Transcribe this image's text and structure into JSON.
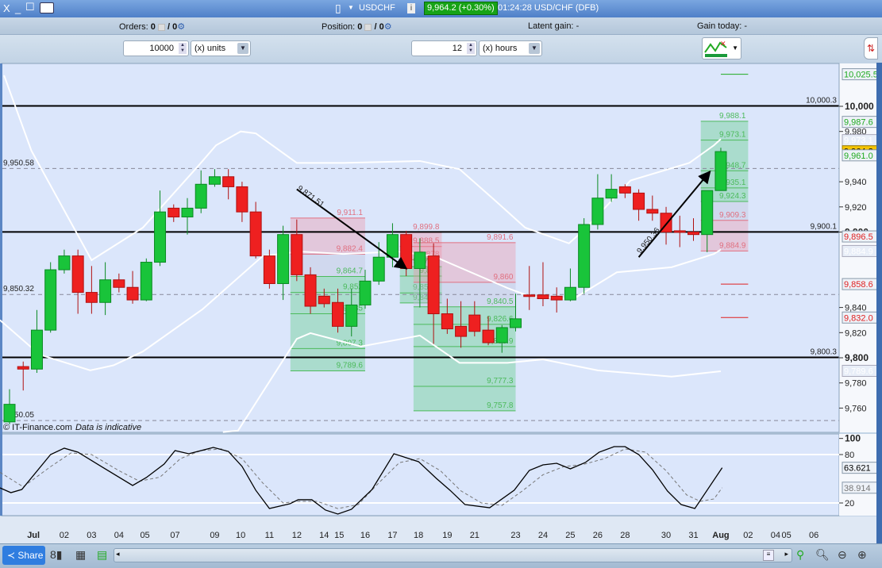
{
  "titlebar": {
    "window_controls": [
      "X",
      "_",
      "☐"
    ],
    "keyboard_icon": "keyboard-icon",
    "symbol": "USDCHF",
    "quote": "9,964.2 (+0.30%)",
    "time_instrument": "01:24:28 USD/CHF (DFB)",
    "quote_color": "#17a317"
  },
  "status": {
    "orders_label": "Orders:",
    "orders_value": "0",
    "orders_total": "/ 0",
    "position_label": "Position:",
    "position_value": "0",
    "position_total": "/ 0",
    "latent_label": "Latent gain:",
    "latent_value": "-",
    "gain_today_label": "Gain today:",
    "gain_today_value": "-"
  },
  "toolbar": {
    "quantity": "10000",
    "quantity_unit": "(x) units",
    "period": "12",
    "period_unit": "(x) hours"
  },
  "chart_data": {
    "type": "candlestick",
    "symbol": "USDCHF",
    "ylim": [
      9745,
      10040
    ],
    "price_ticks": [
      "10,000",
      "9,980",
      "9,940",
      "9,920",
      "9,900",
      "9,840",
      "9,820",
      "9,800",
      "9,780",
      "9,760"
    ],
    "price_tick_values": [
      10000,
      9980,
      9940,
      9920,
      9900,
      9840,
      9820,
      9800,
      9780,
      9760
    ],
    "date_labels": [
      [
        "Jul",
        1.75
      ],
      [
        "02",
        4
      ],
      [
        "03",
        6
      ],
      [
        "04",
        8
      ],
      [
        "05",
        9.9
      ],
      [
        "07",
        12.1
      ],
      [
        "09",
        15
      ],
      [
        "10",
        16.9
      ],
      [
        "11",
        19
      ],
      [
        "12",
        21
      ],
      [
        "14",
        23
      ],
      [
        "15",
        24.1
      ],
      [
        "16",
        26
      ],
      [
        "17",
        28
      ],
      [
        "18",
        29.9
      ],
      [
        "19",
        32
      ],
      [
        "21",
        34
      ],
      [
        "23",
        37
      ],
      [
        "24",
        39
      ],
      [
        "25",
        41
      ],
      [
        "26",
        43
      ],
      [
        "28",
        45
      ],
      [
        "30",
        48
      ],
      [
        "31",
        50
      ],
      [
        "Aug",
        52
      ],
      [
        "02",
        54
      ],
      [
        "04",
        56
      ],
      [
        "05",
        56.8
      ],
      [
        "06",
        58.8
      ]
    ],
    "candles": [
      [
        9749,
        9763,
        9775,
        9747
      ],
      [
        9793,
        9791,
        9797,
        9774
      ],
      [
        9791,
        9822,
        9838,
        9788
      ],
      [
        9822,
        9870,
        9876,
        9820
      ],
      [
        9870,
        9881,
        9886,
        9867
      ],
      [
        9881,
        9852,
        9886,
        9835
      ],
      [
        9852,
        9844,
        9873,
        9835
      ],
      [
        9844,
        9862,
        9876,
        9834
      ],
      [
        9862,
        9856,
        9867,
        9852
      ],
      [
        9856,
        9846,
        9869,
        9843
      ],
      [
        9846,
        9876,
        9879,
        9845
      ],
      [
        9876,
        9916,
        9933,
        9873
      ],
      [
        9919,
        9912,
        9922,
        9908
      ],
      [
        9912,
        9919,
        9927,
        9898
      ],
      [
        9919,
        9938,
        9949,
        9915
      ],
      [
        9938,
        9944,
        9950,
        9936
      ],
      [
        9944,
        9936,
        9950,
        9926
      ],
      [
        9936,
        9916,
        9940,
        9908
      ],
      [
        9916,
        9881,
        9924,
        9879
      ],
      [
        9881,
        9859,
        9886,
        9855
      ],
      [
        9859,
        9898,
        9905,
        9846
      ],
      [
        9898,
        9866,
        9910,
        9861
      ],
      [
        9866,
        9841,
        9872,
        9835
      ],
      [
        9849,
        9843,
        9855,
        9840
      ],
      [
        9844,
        9825,
        9855,
        9820
      ],
      [
        9825,
        9842,
        9855,
        9817
      ],
      [
        9842,
        9861,
        9870,
        9839
      ],
      [
        9861,
        9880,
        9892,
        9858
      ],
      [
        9880,
        9898,
        9907,
        9872
      ],
      [
        9898,
        9871,
        9901,
        9865
      ],
      [
        9871,
        9884,
        9895,
        9840
      ],
      [
        9881,
        9835,
        9891,
        9811
      ],
      [
        9835,
        9823,
        9847,
        9819
      ],
      [
        9825,
        9817,
        9845,
        9808
      ],
      [
        9834,
        9821,
        9845,
        9817
      ],
      [
        9822,
        9812,
        9833,
        9810
      ],
      [
        9812,
        9824,
        9826,
        9804
      ],
      [
        9824,
        9831,
        9851,
        9821
      ],
      [
        9850,
        9849,
        9873,
        9838
      ],
      [
        9850,
        9847,
        9876,
        9841
      ],
      [
        9849,
        9846,
        9856,
        9836
      ],
      [
        9846,
        9856,
        9871,
        9845
      ],
      [
        9856,
        9906,
        9911,
        9851
      ],
      [
        9906,
        9927,
        9946,
        9902
      ],
      [
        9927,
        9934,
        9946,
        9924
      ],
      [
        9936,
        9931,
        9938,
        9927
      ],
      [
        9931,
        9918,
        9934,
        9909
      ],
      [
        9918,
        9915,
        9929,
        9909
      ],
      [
        9915,
        9900,
        9920,
        9890
      ],
      [
        9901,
        9900,
        9913,
        9888
      ],
      [
        9900,
        9898,
        9911,
        9893
      ],
      [
        9898,
        9933,
        9933,
        9884
      ],
      [
        9933,
        9964,
        9967,
        9933
      ]
    ],
    "bands": {
      "upper": [
        [
          -0.4,
          10024.6
        ],
        [
          1.6,
          9964.7
        ],
        [
          6,
          9877.6
        ],
        [
          9.75,
          9903.5
        ],
        [
          13.75,
          9952
        ],
        [
          15.1,
          9969
        ],
        [
          16.9,
          9980
        ],
        [
          18,
          9978.5
        ],
        [
          21,
          9955
        ],
        [
          24.4,
          9955
        ],
        [
          30,
          9956.5
        ],
        [
          32.9,
          9950
        ],
        [
          35.3,
          9927
        ],
        [
          37.7,
          9903.5
        ],
        [
          40.9,
          9891
        ],
        [
          42,
          9901.6
        ],
        [
          45.4,
          9941
        ],
        [
          49.7,
          9955
        ],
        [
          51.5,
          9969
        ],
        [
          52,
          9974
        ]
      ],
      "middle": [
        [
          -0.7,
          9830
        ],
        [
          2.2,
          9802.5
        ],
        [
          5.9,
          9790
        ],
        [
          7.6,
          9794
        ],
        [
          9.75,
          9805
        ],
        [
          14.1,
          9838.5
        ],
        [
          18.5,
          9880.8
        ],
        [
          21.2,
          9884.5
        ],
        [
          24.4,
          9882.6
        ],
        [
          28.4,
          9884.5
        ],
        [
          31,
          9880.8
        ],
        [
          36.4,
          9855.5
        ],
        [
          38,
          9849
        ],
        [
          41.2,
          9846.7
        ],
        [
          44.4,
          9868
        ],
        [
          48.4,
          9872
        ],
        [
          51.5,
          9882.6
        ],
        [
          52,
          9886
        ]
      ],
      "lower": [
        [
          15.6,
          9741
        ],
        [
          16.7,
          9742
        ],
        [
          21,
          9815
        ],
        [
          22,
          9819.6
        ],
        [
          25.7,
          9809
        ],
        [
          30,
          9817.7
        ],
        [
          32.9,
          9796
        ],
        [
          36.4,
          9796
        ],
        [
          39,
          9798.7
        ],
        [
          43,
          9790
        ],
        [
          48.4,
          9785
        ],
        [
          52,
          9789.3
        ]
      ]
    },
    "hlines": [
      {
        "value": 10000.3,
        "label": "10,000.3"
      },
      {
        "value": 9900.1,
        "label": "9,900.1"
      },
      {
        "value": 9800.3,
        "label": "9,800.3"
      }
    ],
    "dashed_lines": [
      {
        "value": 9950.58,
        "label": "9,950.58"
      },
      {
        "value": 9850.32,
        "label": "9,850.32"
      },
      {
        "value": 9750.05,
        "label": "9,750.05"
      }
    ],
    "zones": [
      {
        "from": 21,
        "to": 26,
        "red": [
          9911.1,
          9882.4
        ],
        "neutral": [
          9882.4,
          9864.7
        ],
        "green": [
          9864.7,
          9789.6
        ],
        "levels": [
          "9,911.1",
          "9,882.4",
          "9,864.7",
          "9,852",
          "9,835",
          "9,807.3",
          "9,789.6"
        ],
        "level_values": [
          9911.1,
          9882.4,
          9864.7,
          9852,
          9835,
          9807.3,
          9789.6
        ]
      },
      {
        "from": 29,
        "to": 31.6,
        "red": [
          9899.8,
          9878
        ],
        "neutral": [
          9878,
          9872.5
        ],
        "green": [
          9872.5,
          9843.6
        ],
        "levels": [
          "9,899.8",
          "9,888.5",
          "9,878",
          "9,872.5",
          "9,865",
          "9,851.6",
          "9,843.6"
        ],
        "level_values": [
          9899.8,
          9888.5,
          9878,
          9872.5,
          9865,
          9851.6,
          9843.6
        ]
      },
      {
        "from": 30,
        "to": 37,
        "red": [
          9891.6,
          9860
        ],
        "neutral": [
          9860,
          9840.5
        ],
        "green": [
          9840.5,
          9757.8
        ],
        "levels": [
          "9,891.6",
          "9,860",
          "9,840.5",
          "9,826.6",
          "9,808.9",
          "9,777.3",
          "9,757.8"
        ],
        "level_values": [
          9891.6,
          9860,
          9840.5,
          9826.6,
          9808.9,
          9777.3,
          9757.8
        ]
      },
      {
        "from": 51,
        "to": 54,
        "red": [
          9909.3,
          9884.9
        ],
        "neutral": [
          9924.3,
          9909.3
        ],
        "green": [
          9988.1,
          9924.3
        ],
        "levels": [
          "9,988.1",
          "9,973.1",
          "9,948.7",
          "9,935.1",
          "9,924.3",
          "9,909.3",
          "9,884.9"
        ],
        "level_values": [
          9988.1,
          9973.1,
          9948.7,
          9935.1,
          9924.3,
          9909.3,
          9884.9
        ]
      }
    ],
    "target_lines": [
      {
        "value": 10025.5,
        "color": "#1faa1f"
      },
      {
        "value": 9858.6,
        "color": "#e02020"
      },
      {
        "value": 9832.0,
        "color": "#e02020"
      }
    ],
    "trend_arrows": [
      {
        "label": "9,871.51",
        "from": [
          21,
          9934
        ],
        "to": [
          29,
          9871
        ]
      },
      {
        "label": "9,950.36",
        "from": [
          46,
          9880
        ],
        "to": [
          51.2,
          9948
        ]
      }
    ],
    "axis_tags": [
      {
        "text": "10,025.5",
        "value": 10025.5,
        "kind": "green"
      },
      {
        "text": "9,987.6",
        "value": 9987.6,
        "kind": "green"
      },
      {
        "text": "9,973.1",
        "value": 9973.1,
        "kind": "faded"
      },
      {
        "text": "9,964.2",
        "value": 9964.2,
        "kind": "current"
      },
      {
        "text": "9,961.0",
        "value": 9961.0,
        "kind": "green"
      },
      {
        "text": "9,896.5",
        "value": 9896.5,
        "kind": "red"
      },
      {
        "text": "9,884.9",
        "value": 9884.9,
        "kind": "faded"
      },
      {
        "text": "9,858.6",
        "value": 9858.6,
        "kind": "red"
      },
      {
        "text": "9,832.0",
        "value": 9832.0,
        "kind": "red"
      },
      {
        "text": "9,789.6",
        "value": 9789.6,
        "kind": "faded"
      }
    ],
    "oscillator": {
      "ylim": [
        0,
        100
      ],
      "ticks": [
        "100",
        "80",
        "20"
      ],
      "tick_values": [
        100,
        80,
        20
      ],
      "bands": [
        80,
        20
      ],
      "main": [
        [
          -0.7,
          38.7
        ],
        [
          0.1,
          32.8
        ],
        [
          0.9,
          36.7
        ],
        [
          3,
          80
        ],
        [
          4,
          87.9
        ],
        [
          5,
          83
        ],
        [
          6.7,
          65.3
        ],
        [
          9,
          41.7
        ],
        [
          10,
          51.5
        ],
        [
          11.3,
          68.2
        ],
        [
          12.1,
          84.9
        ],
        [
          13.1,
          81
        ],
        [
          14.9,
          88.8
        ],
        [
          16,
          83.9
        ],
        [
          17,
          65.3
        ],
        [
          18,
          35.8
        ],
        [
          19,
          13.1
        ],
        [
          20.5,
          19
        ],
        [
          21.1,
          24
        ],
        [
          22.1,
          24
        ],
        [
          23.1,
          11.2
        ],
        [
          24,
          6.3
        ],
        [
          25,
          12.2
        ],
        [
          26.5,
          36.7
        ],
        [
          28.1,
          81
        ],
        [
          29.9,
          71.2
        ],
        [
          31.2,
          50.5
        ],
        [
          32.2,
          35.8
        ],
        [
          33.3,
          18
        ],
        [
          35.1,
          14.1
        ],
        [
          36.9,
          35.8
        ],
        [
          38,
          60.3
        ],
        [
          39,
          67.2
        ],
        [
          40,
          69.2
        ],
        [
          41,
          62.3
        ],
        [
          42.1,
          70.2
        ],
        [
          43.1,
          82.9
        ],
        [
          44.2,
          89.8
        ],
        [
          45,
          89.8
        ],
        [
          46,
          80
        ],
        [
          47,
          61.3
        ],
        [
          48.1,
          34.8
        ],
        [
          49.1,
          18
        ],
        [
          50.1,
          13.1
        ],
        [
          52.1,
          63.621
        ]
      ],
      "signal": [
        [
          -0.7,
          58
        ],
        [
          1,
          40
        ],
        [
          3,
          65
        ],
        [
          4.5,
          82
        ],
        [
          6,
          80
        ],
        [
          8,
          60
        ],
        [
          9.5,
          47
        ],
        [
          11,
          52
        ],
        [
          12.5,
          75
        ],
        [
          14,
          85
        ],
        [
          15.5,
          87
        ],
        [
          17,
          75
        ],
        [
          18.5,
          45
        ],
        [
          20,
          20
        ],
        [
          21,
          22
        ],
        [
          22.5,
          22
        ],
        [
          24,
          13
        ],
        [
          25.5,
          18
        ],
        [
          27,
          45
        ],
        [
          28.5,
          70
        ],
        [
          30,
          75
        ],
        [
          31.5,
          60
        ],
        [
          33,
          35
        ],
        [
          34.5,
          20
        ],
        [
          36,
          17
        ],
        [
          37.5,
          35
        ],
        [
          39,
          55
        ],
        [
          40.5,
          65
        ],
        [
          42,
          68
        ],
        [
          43.5,
          75
        ],
        [
          45,
          87
        ],
        [
          46.5,
          83
        ],
        [
          48,
          60
        ],
        [
          49.5,
          30
        ],
        [
          50.5,
          22
        ],
        [
          51.5,
          25
        ],
        [
          52.1,
          38.914
        ]
      ],
      "main_label": "63.621",
      "signal_label": "38.914"
    },
    "colors": {
      "up": "#19c43a",
      "down": "#ee2020",
      "background": "#dbe6fb",
      "band": "#ffffff"
    }
  },
  "watermark": {
    "brand": "© IT-Finance.com",
    "note": "Data is indicative"
  },
  "bottombar": {
    "share": "Share"
  }
}
